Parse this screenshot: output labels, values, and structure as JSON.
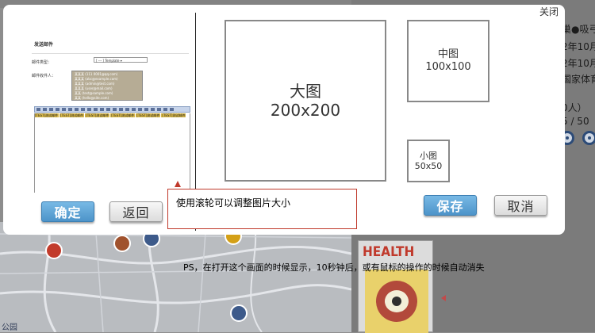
{
  "dialog": {
    "close_label": "关闭",
    "hint": "使用滚轮可以调整图片大小",
    "confirm_label": "确定",
    "back_label": "返回",
    "save_label": "保存",
    "cancel_label": "取消"
  },
  "sizes": {
    "large": {
      "name": "大图",
      "dims": "200x200"
    },
    "medium": {
      "name": "中图",
      "dims": "100x100"
    },
    "small": {
      "name": "小图",
      "dims": "50x50"
    }
  },
  "preview": {
    "title": "发送邮件",
    "field1_label": "邮件类型：",
    "field1_value": "[ --- ] Template ▾",
    "field2_label": "邮件收件人：",
    "recipients": [
      "某某某 (111 0001@qq.com)",
      "某某某 (abc@example.com)",
      "某某某 (admin@test.com)",
      "某某某 (user@mail.com)",
      "某某 (test@sample.com)",
      "某某 (hello@site.com)"
    ],
    "tags": [
      "[TEST]测试邮件",
      "[TEST]测试邮件",
      "[TEST]测试邮件",
      "[TEST]测试邮件",
      "[TEST]测试邮件",
      "[TEST]测试邮件"
    ]
  },
  "background": {
    "right_snippets": [
      "巢●吸弓",
      "2年10月",
      "2年10月",
      "国家体育",
      "0人）",
      "5 / 50"
    ],
    "health_title": "HEALTH",
    "map_label": "公园"
  },
  "note": "PS，在打开这个画面的时候显示，10秒钟后，或有鼠标的操作的时候自动消失",
  "colors": {
    "primary_button": "#4d94c9",
    "hint_border": "#c0392b",
    "overlay": "#8d8d8d"
  }
}
